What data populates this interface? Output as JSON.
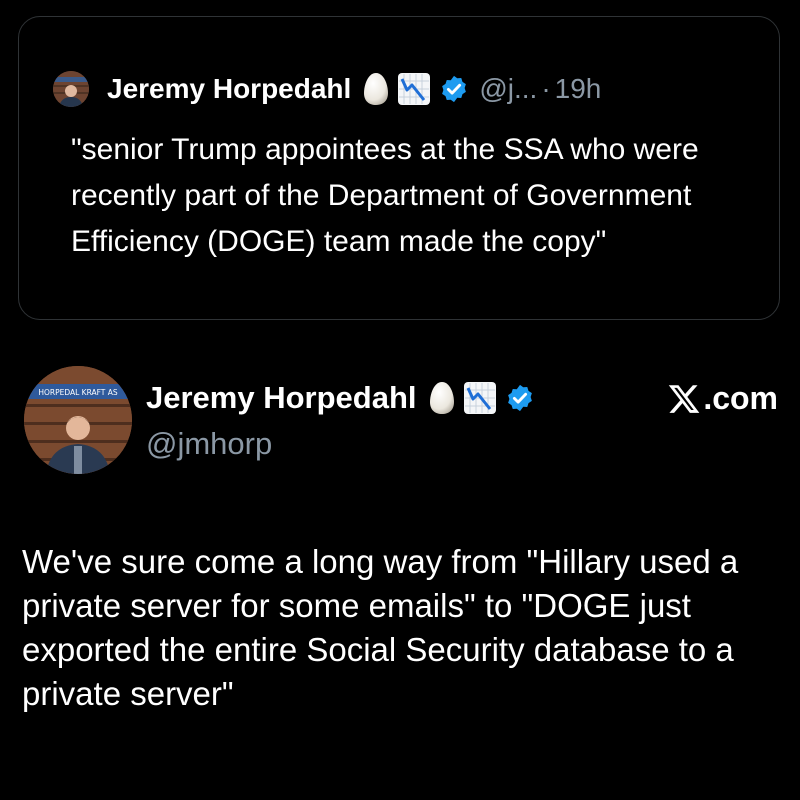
{
  "quoted_tweet": {
    "author_name": "Jeremy Horpedahl",
    "handle": "@j...",
    "separator": "·",
    "time": "19h",
    "text": "\"senior Trump appointees at the SSA who were recently part of the Department of Government Efficiency (DOGE) team made the copy\"",
    "icons": [
      "avatar",
      "egg-emoji-icon",
      "chart-decreasing-emoji-icon",
      "verified-badge-icon"
    ]
  },
  "main_tweet": {
    "author_name": "Jeremy Horpedahl",
    "handle": "@jmhorp",
    "brand": ".com",
    "avatar_sign_text": "HORPEDAL KRAFT AS",
    "text": "We've sure come a long way from \"Hillary used a private server for some emails\" to \"DOGE just exported the entire Social Security database to a private server\"",
    "icons": [
      "avatar",
      "egg-emoji-icon",
      "chart-decreasing-emoji-icon",
      "verified-badge-icon",
      "x-logo-icon"
    ]
  },
  "colors": {
    "background": "#000000",
    "text_primary": "#ffffff",
    "text_secondary": "#8b98a5",
    "verified_blue": "#1d9bf0",
    "card_border": "#2f3336"
  }
}
